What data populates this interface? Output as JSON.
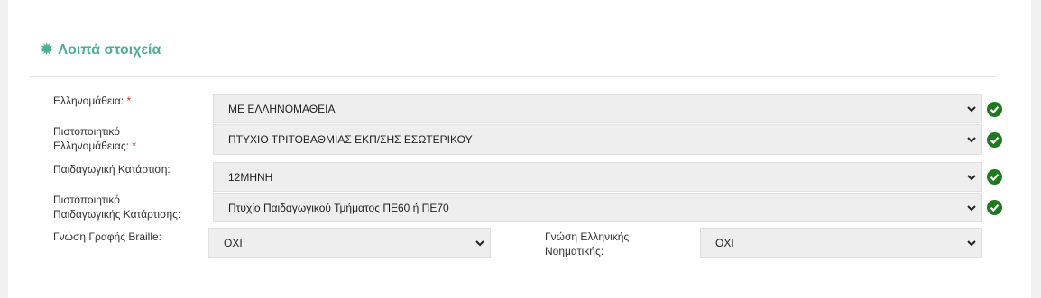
{
  "section": {
    "title": "Λοιπά στοιχεία",
    "icon": "gear-icon",
    "accent_color": "#4eae96"
  },
  "fields": {
    "greek_proficiency": {
      "label": "Ελληνομάθεια:",
      "required_mark": "*",
      "value": "ΜΕ ΕΛΛΗΝΟΜΑΘΕΙΑ",
      "valid": true
    },
    "greek_certificate": {
      "label_line1": "Πιστοποιητικό",
      "label_line2": "Ελληνομάθειας:",
      "required_mark": "*",
      "value": "ΠΤΥΧΙΟ ΤΡΙΤΟΒΑΘΜΙΑΣ ΕΚΠ/ΣΗΣ ΕΣΩΤΕΡΙΚΟΥ",
      "valid": true
    },
    "pedagogical_training": {
      "label": "Παιδαγωγική Κατάρτιση:",
      "value": "12ΜΗΝΗ",
      "valid": true
    },
    "pedagogical_certificate": {
      "label_line1": "Πιστοποιητικό",
      "label_line2": "Παιδαγωγικής Κατάρτισης:",
      "value": "Πτυχίο Παιδαγωγικού Τμήματος ΠΕ60 ή ΠΕ70",
      "valid": true
    },
    "braille": {
      "label": "Γνώση Γραφής Braille:",
      "value": "ΟΧΙ"
    },
    "sign_language": {
      "label_line1": "Γνώση Ελληνικής",
      "label_line2": "Νοηματικής:",
      "value": "ΟΧΙ"
    }
  },
  "colors": {
    "valid_check": "#1f7a1f",
    "required": "#c9302c",
    "select_bg": "#eeeeee"
  }
}
